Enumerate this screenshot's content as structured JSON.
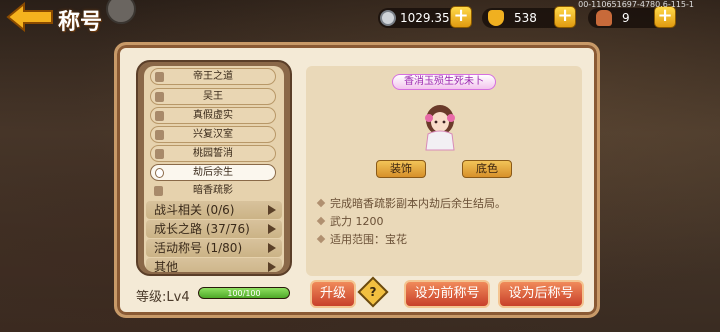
{
  "header": {
    "title": "称号",
    "build_id": "00-110651697-4780.6-115-1"
  },
  "resources": {
    "silver": "1029.35万",
    "gold": "538",
    "item": "9"
  },
  "list": {
    "subitems": [
      {
        "label": "帝王之道",
        "locked": true
      },
      {
        "label": "吴王",
        "locked": true
      },
      {
        "label": "真假虚实",
        "locked": true
      },
      {
        "label": "兴复汉室",
        "locked": true
      },
      {
        "label": "桃园誓消",
        "locked": true
      },
      {
        "label": "劫后余生",
        "locked": false,
        "selected": true
      },
      {
        "label": "暗香疏影",
        "locked": true
      }
    ],
    "categories": [
      {
        "label": "战斗相关 (0/6)"
      },
      {
        "label": "成长之路 (37/76)"
      },
      {
        "label": "活动称号 (1/80)"
      },
      {
        "label": "其他"
      }
    ]
  },
  "level": {
    "label": "等级:Lv4",
    "progress_text": "100/100",
    "progress_fraction": 1.0
  },
  "detail": {
    "title_badge": "香消玉殒生死未卜",
    "decorate_label": "装饰",
    "color_label": "底色",
    "lines": [
      "完成暗香疏影副本内劫后余生结局。",
      "武力 1200",
      "适用范围：宝花"
    ]
  },
  "buttons": {
    "upgrade": "升级",
    "help": "?",
    "set_prefix": "设为前称号",
    "set_suffix": "设为后称号"
  },
  "colors": {
    "accent_gold": "#f2c040",
    "title_pink": "#9b2ab0",
    "button_red": "#c8402a"
  }
}
